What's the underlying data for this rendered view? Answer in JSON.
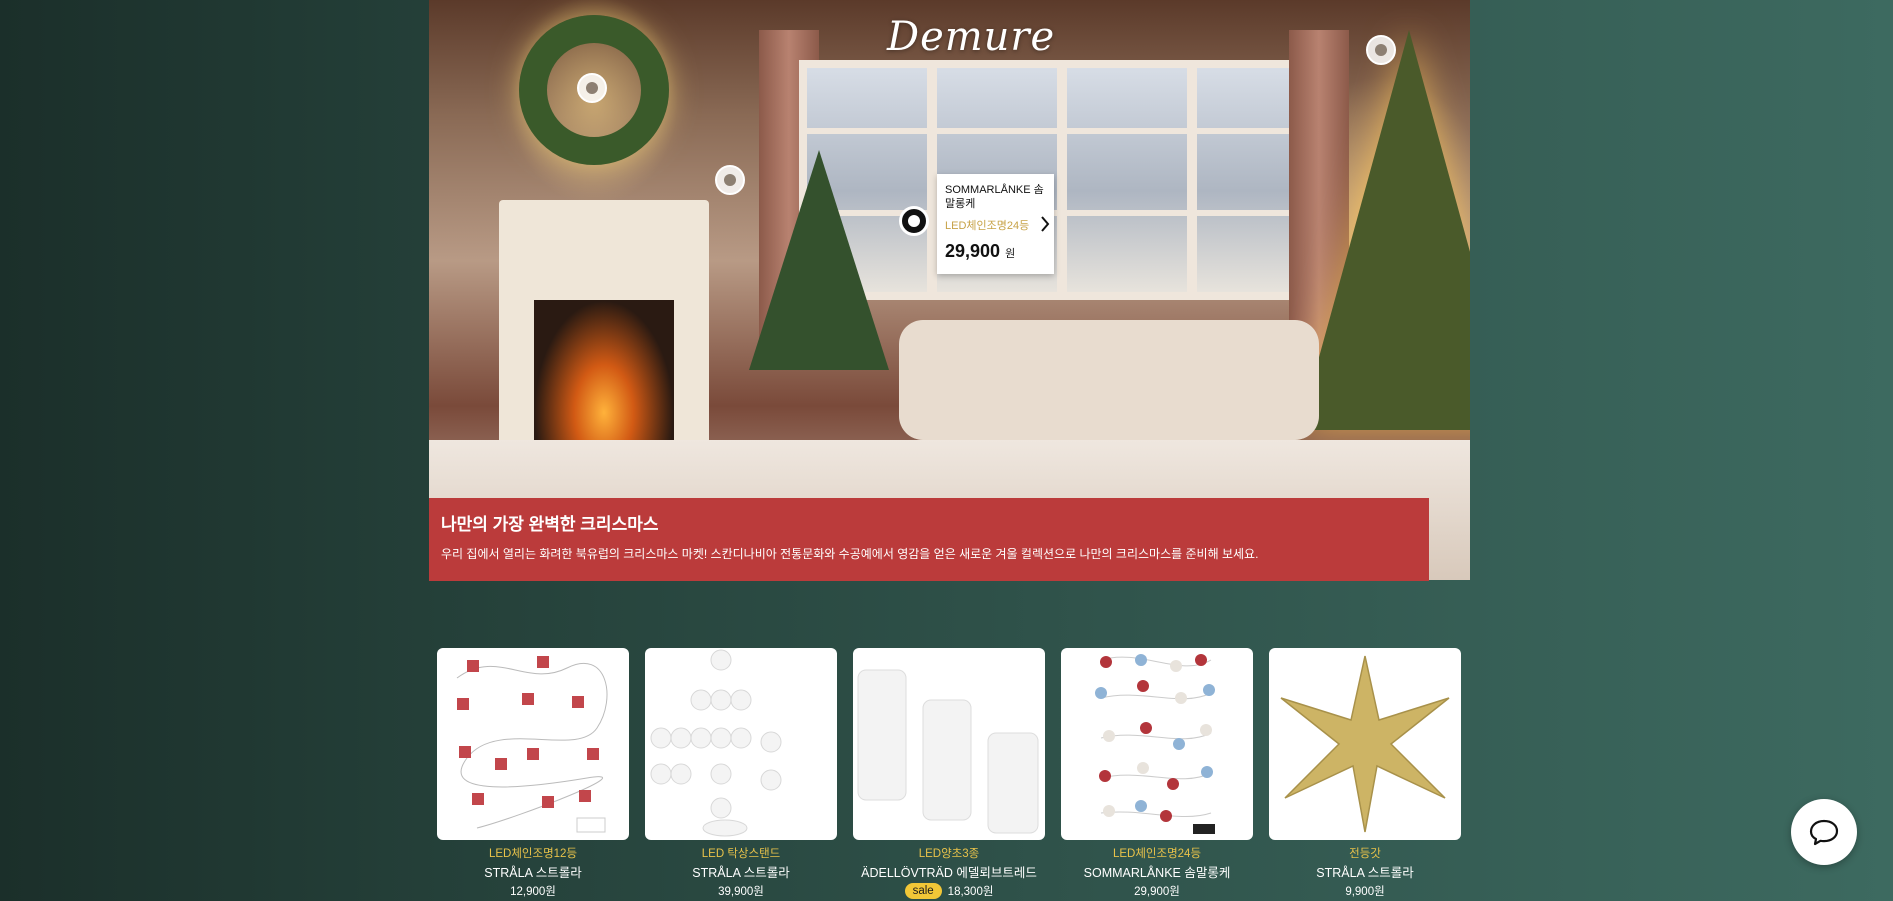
{
  "brand": {
    "logo": "Demure"
  },
  "hero": {
    "popup": {
      "name": "SOMMARLÅNKE 솜말롱케",
      "subtitle": "LED체인조명24등",
      "price": "29,900",
      "currency": "원"
    },
    "banner": {
      "title": "나만의 가장 완벽한 크리스마스",
      "description": "우리 집에서 열리는 화려한 북유럽의 크리스마스 마켓! 스칸디나비아 전통문화와 수공예에서 영감을 얻은 새로운 겨울 컬렉션으로 나만의 크리스마스를 준비해 보세요."
    }
  },
  "products": [
    {
      "category": "LED체인조명12등",
      "name": "STRÅLA 스트롤라",
      "price": "12,900원",
      "sale": ""
    },
    {
      "category": "LED 탁상스탠드",
      "name": "STRÅLA 스트롤라",
      "price": "39,900원",
      "sale": ""
    },
    {
      "category": "LED양초3종",
      "name": "ÄDELLÖVTRÄD 에델뢰브트레드",
      "price": "18,300원",
      "sale": "sale"
    },
    {
      "category": "LED체인조명24등",
      "name": "SOMMARLÅNKE 솜말롱케",
      "price": "29,900원",
      "sale": ""
    },
    {
      "category": "전등갓",
      "name": "STRÅLA 스트롤라",
      "price": "9,900원",
      "sale": ""
    }
  ],
  "icons": {
    "chat": "chat-bubble-icon",
    "popup_arrow": "chevron-right-icon"
  },
  "colors": {
    "banner": "#bb3b3b",
    "accent": "#e8c24a",
    "sale_badge": "#f2c737"
  }
}
